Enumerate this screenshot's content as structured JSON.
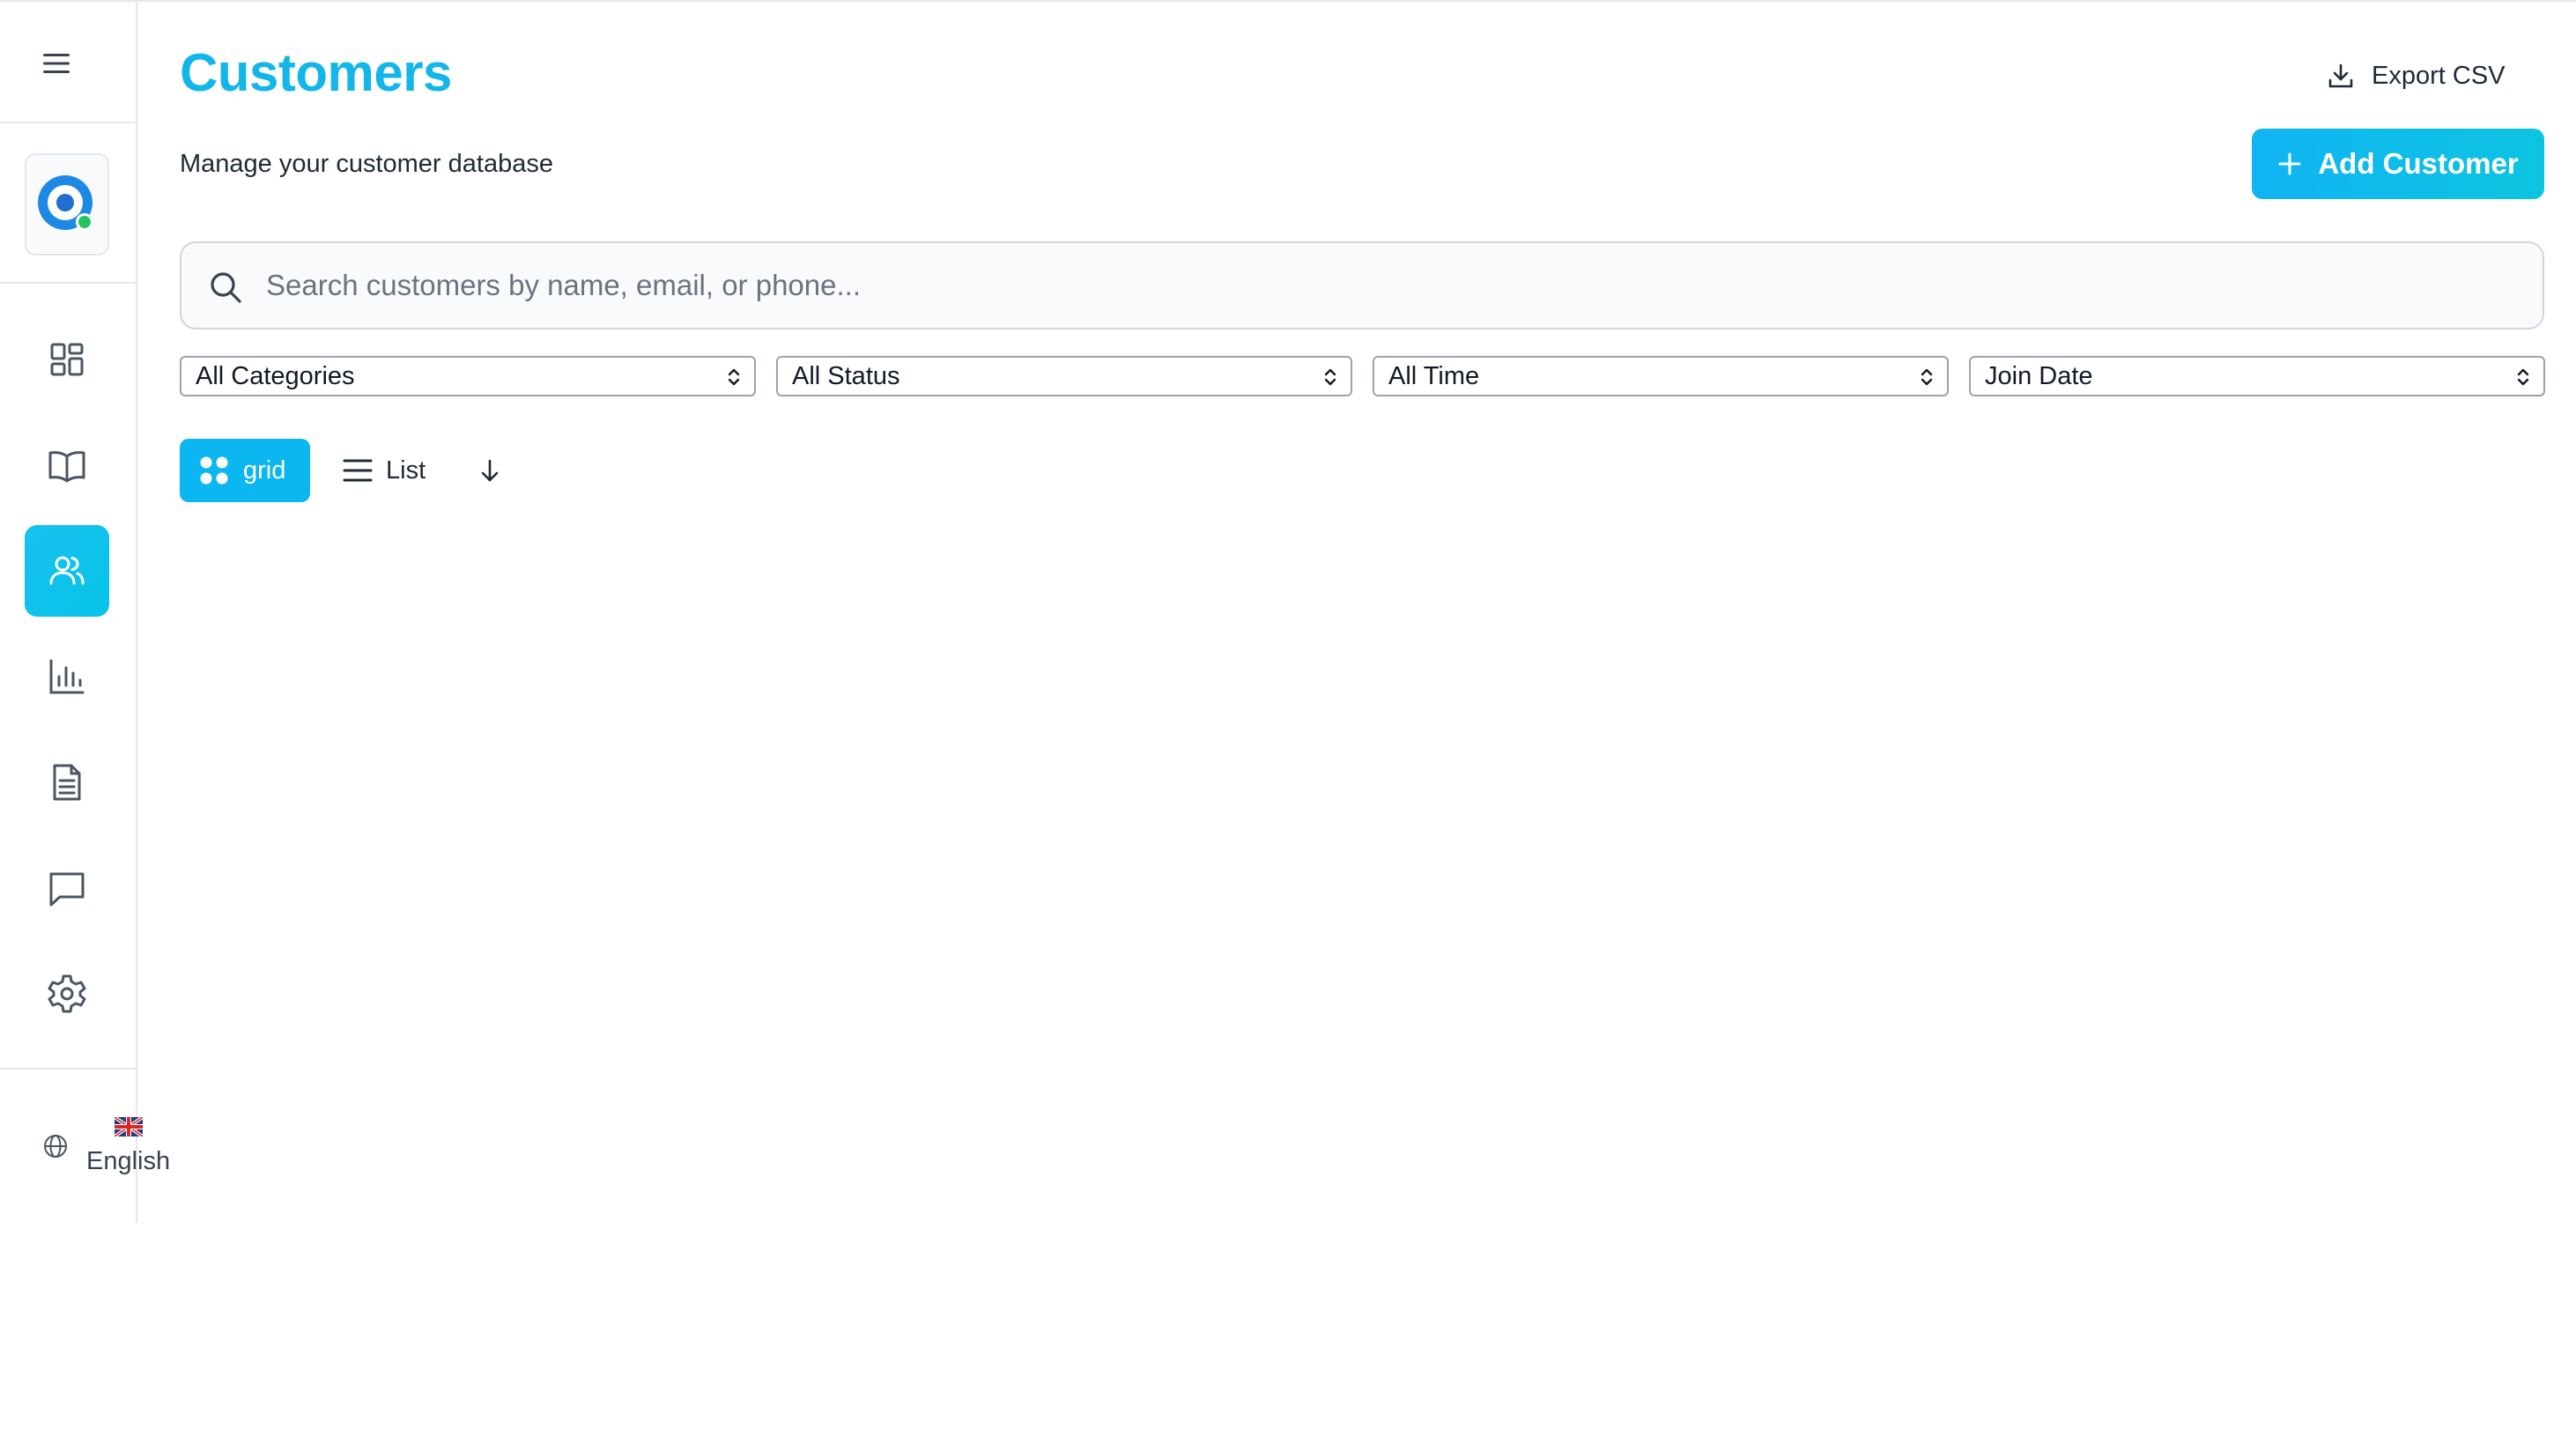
{
  "app": {
    "page_title": "Customers",
    "page_subtitle": "Manage your customer database"
  },
  "sidebar": {
    "menu_icon": "hamburger-icon",
    "logo_icon": "app-logo",
    "items": [
      {
        "key": "dashboard",
        "icon": "dashboard-grid-icon",
        "active": false
      },
      {
        "key": "catalog",
        "icon": "book-open-icon",
        "active": false
      },
      {
        "key": "customers",
        "icon": "users-icon",
        "active": true
      },
      {
        "key": "analytics",
        "icon": "bar-chart-icon",
        "active": false
      },
      {
        "key": "documents",
        "icon": "document-icon",
        "active": false
      },
      {
        "key": "messages",
        "icon": "chat-icon",
        "active": false
      },
      {
        "key": "settings",
        "icon": "gear-icon",
        "active": false
      }
    ],
    "language": {
      "icon": "globe-icon",
      "flag": "uk-flag-icon",
      "label": "English"
    }
  },
  "header": {
    "export_label": "Export CSV",
    "add_label": "Add Customer"
  },
  "search": {
    "placeholder": "Search customers by name, email, or phone...",
    "value": ""
  },
  "filters": [
    {
      "key": "category",
      "selected": "All Categories"
    },
    {
      "key": "status",
      "selected": "All Status"
    },
    {
      "key": "time",
      "selected": "All Time"
    },
    {
      "key": "sort",
      "selected": "Join Date"
    }
  ],
  "view": {
    "grid_label": "grid",
    "list_label": "List",
    "active": "grid",
    "sort_direction_icon": "arrow-down-icon"
  },
  "colors": {
    "accent": "#13b6e9",
    "button": "#0cb6f0",
    "sidebar_active": "#18c2f0",
    "border": "#e5e7eb",
    "text": "#1f2937"
  }
}
